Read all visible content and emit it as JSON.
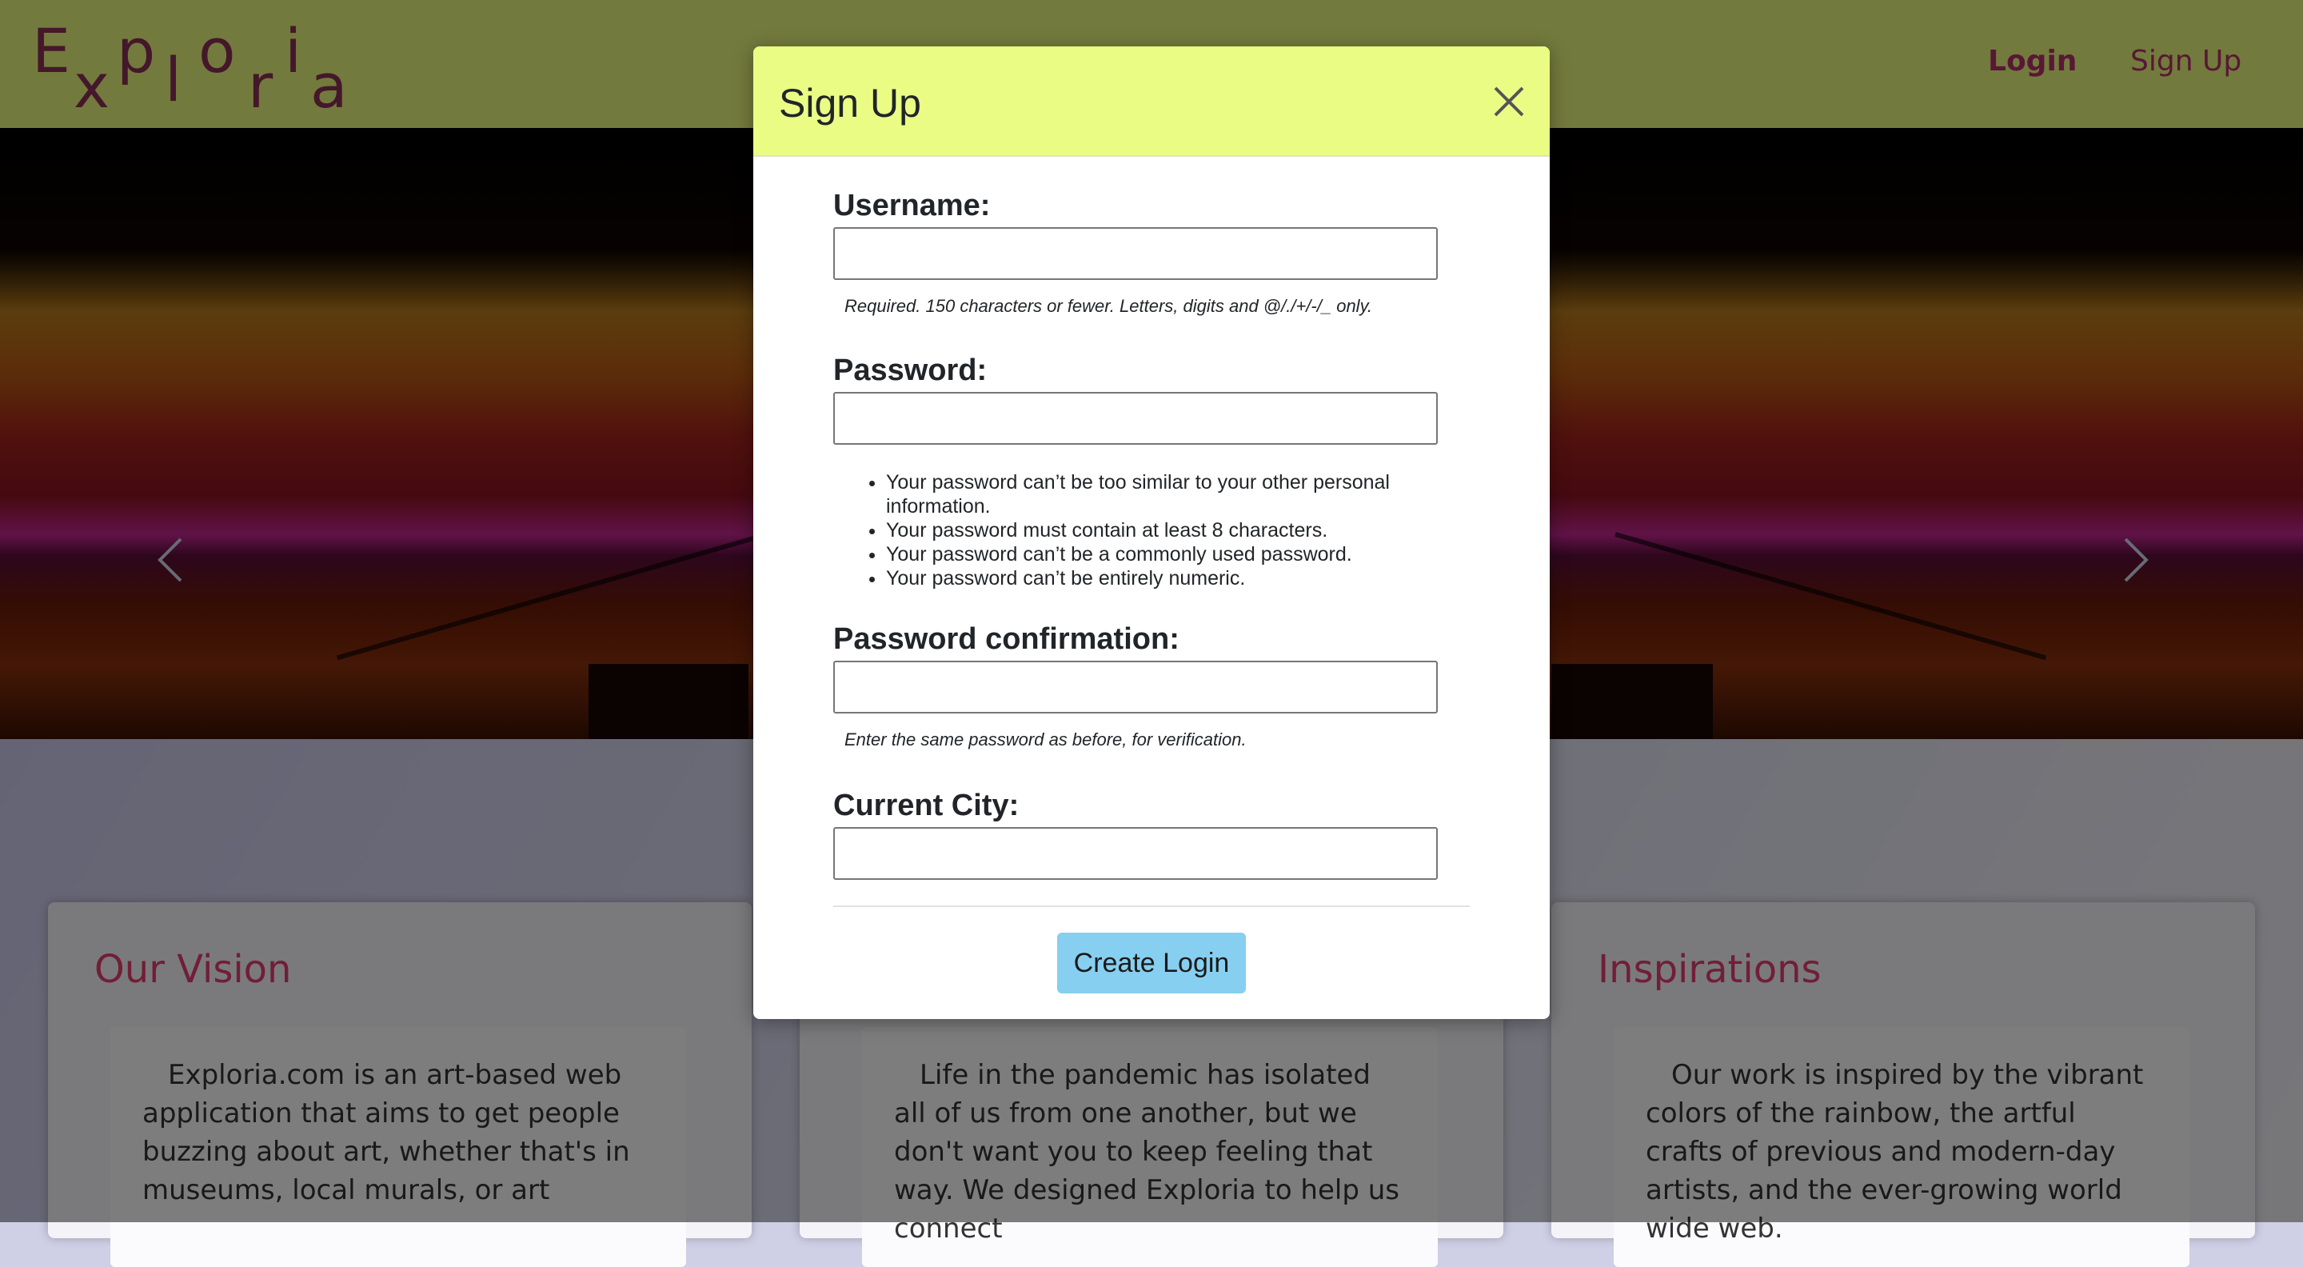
{
  "navbar": {
    "logo_letters": [
      "E",
      "x",
      "p",
      "l",
      "o",
      "r",
      "i",
      "a"
    ],
    "login_label": "Login",
    "signup_label": "Sign Up"
  },
  "cards": [
    {
      "title": "Our Vision",
      "body": "Exploria.com is an art-based web application that aims to get people buzzing about art, whether that's in museums, local murals, or art"
    },
    {
      "title": "",
      "body": "Life in the pandemic has isolated all of us from one another, but we don't want you to keep feeling that way. We designed Exploria to help us connect"
    },
    {
      "title": "Inspirations",
      "body": "Our work is inspired by the vibrant colors of the rainbow, the artful crafts of previous and modern-day artists, and the ever-growing world wide web."
    }
  ],
  "modal": {
    "title": "Sign Up",
    "username_label": "Username:",
    "username_value": "",
    "username_help": "Required. 150 characters or fewer. Letters, digits and @/./+/-/_ only.",
    "password_label": "Password:",
    "password_value": "",
    "password_rules": [
      "Your password can’t be too similar to your other personal information.",
      "Your password must contain at least 8 characters.",
      "Your password can’t be a commonly used password.",
      "Your password can’t be entirely numeric."
    ],
    "password_confirm_label": "Password confirmation:",
    "password_confirm_value": "",
    "password_confirm_help": "Enter the same password as before, for verification.",
    "city_label": "Current City:",
    "city_value": "",
    "submit_label": "Create Login"
  },
  "colors": {
    "navbar_bg": "#e6f57a",
    "brand": "#b0306a",
    "modal_header_bg": "#eafc84",
    "submit_bg": "#86cff0",
    "card_title": "#e23c6e"
  },
  "icons": {
    "close": "close-icon",
    "prev": "chevron-left-icon",
    "next": "chevron-right-icon"
  }
}
